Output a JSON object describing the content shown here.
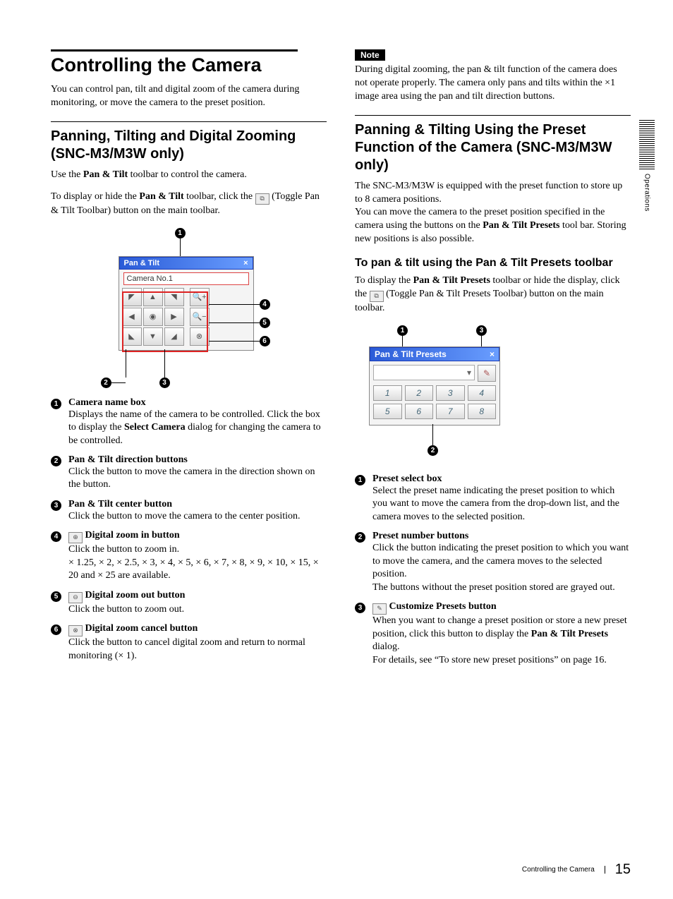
{
  "sideTab": "Operations",
  "footer": {
    "title": "Controlling the Camera",
    "page": "15"
  },
  "left": {
    "title": "Controlling the Camera",
    "intro": "You can control pan, tilt and digital zoom of the camera during monitoring, or move the camera to the preset position.",
    "sub": "Panning, Tilting and Digital Zooming (SNC-M3/M3W only)",
    "p1a": "Use the ",
    "p1b": "Pan & Tilt",
    "p1c": " toolbar to control the camera.",
    "p2a": "To display or hide the ",
    "p2b": "Pan & Tilt",
    "p2c": " toolbar, click the ",
    "p2d": " (Toggle Pan & Tilt Toolbar) button on the main toolbar.",
    "toolbarTitle": "Pan & Tilt",
    "toolbarX": "×",
    "cameraName": "Camera No.1",
    "items": [
      {
        "n": "1",
        "title": "Camera name box",
        "desc": "Displays the name of the camera to be controlled. Click the box to display the <b>Select Camera</b> dialog for changing the camera to be controlled."
      },
      {
        "n": "2",
        "title": "Pan & Tilt direction buttons",
        "desc": "Click the button to move the camera in the direction shown on the button."
      },
      {
        "n": "3",
        "title": "Pan & Tilt center button",
        "desc": "Click the button to move the camera to the center position."
      },
      {
        "n": "4",
        "iconLabel": "⊕",
        "title": "Digital zoom in button",
        "desc": "Click the button to zoom in.<br>× 1.25, × 2, × 2.5, × 3, × 4, × 5, × 6, × 7, × 8, × 9, × 10, × 15, × 20 and × 25 are available."
      },
      {
        "n": "5",
        "iconLabel": "⊖",
        "title": "Digital zoom out button",
        "desc": "Click the button to zoom out."
      },
      {
        "n": "6",
        "iconLabel": "⊗",
        "title": "Digital zoom cancel button",
        "desc": "Click the button to cancel digital zoom and return to normal monitoring (× 1)."
      }
    ]
  },
  "right": {
    "noteLabel": "Note",
    "noteText": "During digital zooming, the pan & tilt function of the camera does not operate properly. The camera only pans and tilts within the ×1 image area using the pan and tilt direction buttons.",
    "sub": "Panning & Tilting Using the Preset Function of the Camera (SNC-M3/M3W only)",
    "p1": "The SNC-M3/M3W is equipped with the preset function to store up to 8 camera positions.<br>You can move the camera to the preset position specified in the camera using the buttons on the <b>Pan &amp; Tilt Presets</b> tool bar. Storing new positions is also possible.",
    "minor": "To pan & tilt using the Pan & Tilt Presets toolbar",
    "p2a": "To display the ",
    "p2b": "Pan & Tilt Presets",
    "p2c": " toolbar or hide the display, click the ",
    "p2d": " (Toggle Pan & Tilt Presets Toolbar) button on the main toolbar.",
    "toolbarTitle": "Pan & Tilt Presets",
    "toolbarX": "×",
    "presetNums": [
      "1",
      "2",
      "3",
      "4",
      "5",
      "6",
      "7",
      "8"
    ],
    "items": [
      {
        "n": "1",
        "title": "Preset select box",
        "desc": "Select the preset name indicating the preset position to which you want to move the camera from the drop-down list, and the camera moves to the selected position."
      },
      {
        "n": "2",
        "title": "Preset number buttons",
        "desc": "Click the button indicating the preset position to which you want to move the camera, and the camera moves to the selected position.<br>The buttons without the preset position stored are grayed out."
      },
      {
        "n": "3",
        "iconLabel": "✎",
        "title": "Customize Presets button",
        "desc": "When you want to change a preset position or store a new preset position, click this button to display the <b>Pan &amp; Tilt Presets</b> dialog.<br>For details, see “To store new preset positions” on page 16."
      }
    ]
  }
}
